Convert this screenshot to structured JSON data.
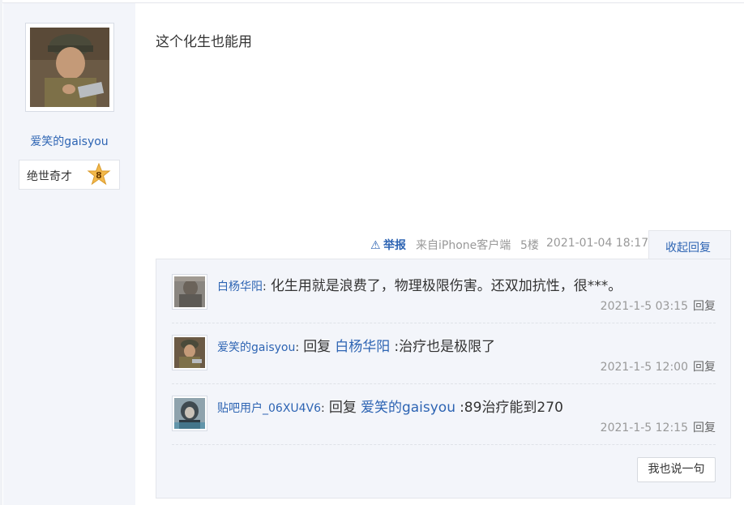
{
  "author": {
    "name": "爱笑的gaisyou",
    "level_name": "绝世奇才",
    "level_number": "8",
    "avatar_icon": "soldier-avatar"
  },
  "post": {
    "content": "这个化生也能用",
    "report_label": "举报",
    "client": "来自iPhone客户端",
    "floor": "5楼",
    "time": "2021-01-04 18:17",
    "collapse_label": "收起回复"
  },
  "replies": [
    {
      "user": "白杨华阳",
      "colon": ":",
      "prefix": "",
      "mention": "",
      "text": "化生用就是浪费了，物理极限伤害。还双加抗性，很***。",
      "time": "2021-1-5 03:15",
      "reply_label": "回复",
      "avatar_icon": "gray-user-avatar"
    },
    {
      "user": "爱笑的gaisyou",
      "colon": ":",
      "prefix": "回复",
      "mention": "白杨华阳",
      "text": ":治疗也是极限了",
      "time": "2021-1-5 12:00",
      "reply_label": "回复",
      "avatar_icon": "soldier-avatar"
    },
    {
      "user": "贴吧用户_06XU4V6",
      "colon": ":",
      "prefix": "回复",
      "mention": "爱笑的gaisyou",
      "text": ":89治疗能到270",
      "time": "2021-1-5 12:15",
      "reply_label": "回复",
      "avatar_icon": "masked-user-avatar"
    }
  ],
  "say_button_label": "我也说一句",
  "colors": {
    "link": "#2d64b3",
    "panel_bg": "#f3f5fa",
    "muted_text": "#999999"
  }
}
